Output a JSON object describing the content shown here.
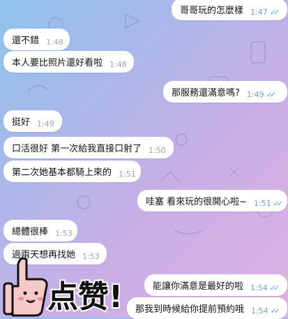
{
  "messages": [
    {
      "text": "哥哥玩的怎麼樣",
      "time": "1:47",
      "dir": "out"
    },
    {
      "text": "還不錯",
      "time": "1:48",
      "dir": "in"
    },
    {
      "text": "本人要比照片還好看啦",
      "time": "1:48",
      "dir": "in"
    },
    {
      "text": "那服務還滿意嗎?",
      "time": "1:49",
      "dir": "out"
    },
    {
      "text": "挺好",
      "time": "1:49",
      "dir": "in"
    },
    {
      "text": "口活很好 第一次給我直接口射了",
      "time": "1:50",
      "dir": "in"
    },
    {
      "text": "第二次她基本都騎上來的",
      "time": "1:51",
      "dir": "in"
    },
    {
      "text": "哇塞 看來玩的很開心啦~",
      "time": "1:51",
      "dir": "out"
    },
    {
      "text": "總體很棒",
      "time": "1:53",
      "dir": "in"
    },
    {
      "text": "過兩天想再找她",
      "time": "1:53",
      "dir": "in"
    },
    {
      "text": "能讓你滿意是最好的啦",
      "time": "1:54",
      "dir": "out"
    },
    {
      "text": "那我到時候給你提前預約哦",
      "time": "1:54",
      "dir": "out"
    }
  ],
  "sticker": {
    "text": "点赞!"
  },
  "colors": {
    "tick": "#5aa6e0",
    "time_in": "#a0a4a8",
    "time_out": "#6fa3c8"
  }
}
